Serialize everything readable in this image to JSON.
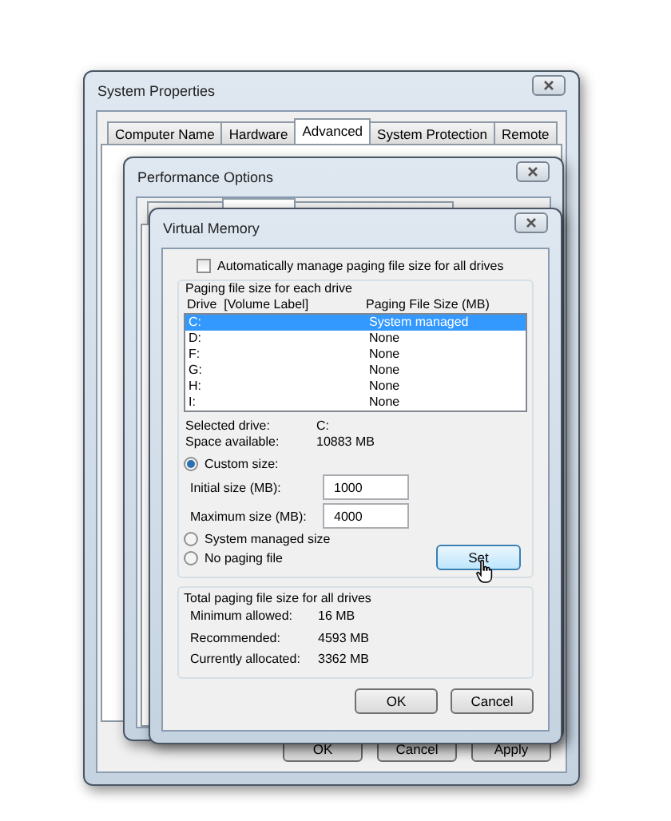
{
  "system_properties": {
    "title": "System Properties",
    "tabs": [
      {
        "label": "Computer Name",
        "selected": false
      },
      {
        "label": "Hardware",
        "selected": false
      },
      {
        "label": "Advanced",
        "selected": true
      },
      {
        "label": "System Protection",
        "selected": false
      },
      {
        "label": "Remote",
        "selected": false
      }
    ],
    "buttons": [
      "OK",
      "Cancel",
      "Apply"
    ]
  },
  "performance_options": {
    "title": "Performance Options",
    "tabs": [
      {
        "selected": false
      },
      {
        "selected": true
      },
      {
        "selected": false
      }
    ]
  },
  "virtual_memory": {
    "title": "Virtual Memory",
    "auto_manage": {
      "label": "Automatically manage paging file size for all drives",
      "checked": false
    },
    "group_title": "Paging file size for each drive",
    "columns": [
      "Drive  [Volume Label]",
      "Paging File Size (MB)"
    ],
    "drives": [
      {
        "drive": "C:",
        "size": "System managed",
        "selected": true
      },
      {
        "drive": "D:",
        "size": "None",
        "selected": false
      },
      {
        "drive": "F:",
        "size": "None",
        "selected": false
      },
      {
        "drive": "G:",
        "size": "None",
        "selected": false
      },
      {
        "drive": "H:",
        "size": "None",
        "selected": false
      },
      {
        "drive": "I:",
        "size": "None",
        "selected": false
      }
    ],
    "info": [
      {
        "label": "Selected drive:",
        "value": "C:"
      },
      {
        "label": "Space available:",
        "value": "10883 MB"
      }
    ],
    "options": [
      {
        "label": "Custom size:",
        "selected": true
      },
      {
        "label": "System managed size",
        "selected": false
      },
      {
        "label": "No paging file",
        "selected": false
      }
    ],
    "fields": [
      {
        "label": "Initial size (MB):",
        "value": "1000"
      },
      {
        "label": "Maximum size (MB):",
        "value": "4000"
      }
    ],
    "set_button": "Set",
    "totals": {
      "title": "Total paging file size for all drives",
      "rows": [
        {
          "label": "Minimum allowed:",
          "value": "16 MB"
        },
        {
          "label": "Recommended:",
          "value": "4593 MB"
        },
        {
          "label": "Currently allocated:",
          "value": "3362 MB"
        }
      ]
    },
    "buttons": [
      "OK",
      "Cancel"
    ]
  }
}
